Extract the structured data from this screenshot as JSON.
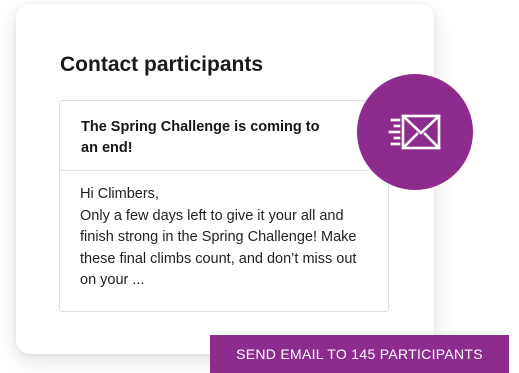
{
  "panel": {
    "title": "Contact participants"
  },
  "message": {
    "subject": "The Spring Challenge is coming to an end!",
    "greeting": "Hi Climbers,",
    "body": "Only a few days left to give it your all and finish strong in the Spring Challenge! Make these final climbs count, and don’t miss out on your ..."
  },
  "badge": {
    "icon": "email-send-icon",
    "color": "#8e2c8e"
  },
  "send_button": {
    "label": "SEND EMAIL TO 145 PARTICIPANTS",
    "color": "#8e2c8e"
  }
}
